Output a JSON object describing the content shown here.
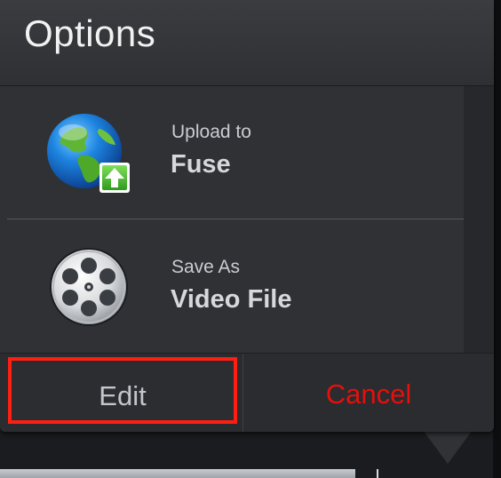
{
  "dialog": {
    "title": "Options"
  },
  "options": [
    {
      "icon": "globe-upload-icon",
      "small_label": "Upload to",
      "big_label": "Fuse"
    },
    {
      "icon": "film-reel-icon",
      "small_label": "Save As",
      "big_label": "Video File"
    }
  ],
  "footer": {
    "edit_label": "Edit",
    "cancel_label": "Cancel"
  },
  "colors": {
    "cancel_text": "#e4100c",
    "highlight_border": "#ff1e12",
    "panel_background": "#303236"
  }
}
